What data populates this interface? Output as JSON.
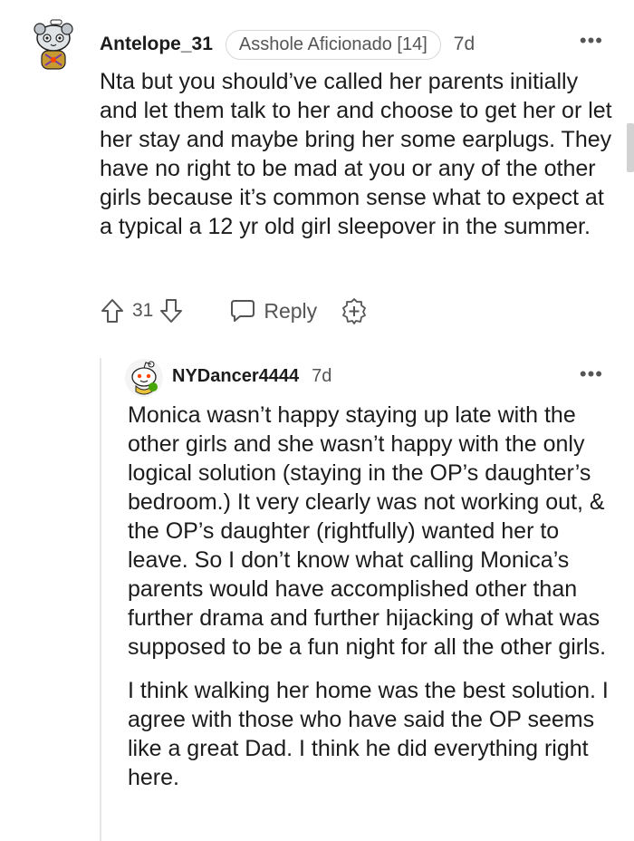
{
  "comment": {
    "username": "Antelope_31",
    "flair": "Asshole Aficionado [14]",
    "age": "7d",
    "more_label": "•••",
    "body": "Nta but you should’ve called her parents initially and let them talk to her and choose to get her or let her stay and maybe bring her some earplugs. They have no right to be mad at you or any of the other girls because it’s common sense what to expect at a typical a 12 yr old girl sleepover in the summer.",
    "score": "31",
    "reply_label": "Reply",
    "icons": [
      "upvote-icon",
      "downvote-icon",
      "reply-bubble-icon",
      "award-plus-icon",
      "more-icon"
    ]
  },
  "reply": {
    "username": "NYDancer4444",
    "age": "7d",
    "more_label": "•••",
    "paragraphs": [
      "Monica wasn’t happy staying up late with the other girls and she wasn’t happy with the only logical solution (staying in the OP’s daughter’s bedroom.) It very clearly was not working out, & the OP’s daughter (rightfully) wanted her to leave. So I don’t know what calling Monica’s parents would have accomplished other than further drama and further hijacking of what was supposed to be a fun night for all the other girls.",
      "I think walking her home was the best solution. I agree with those who have said the OP seems like a great Dad. I think he did everything right here."
    ]
  },
  "colors": {
    "text": "#1c1c1c",
    "meta": "#555555",
    "thread_line": "#e6e6e6",
    "flair_border": "#d7d7d7",
    "reddit_orange": "#ff4500"
  }
}
